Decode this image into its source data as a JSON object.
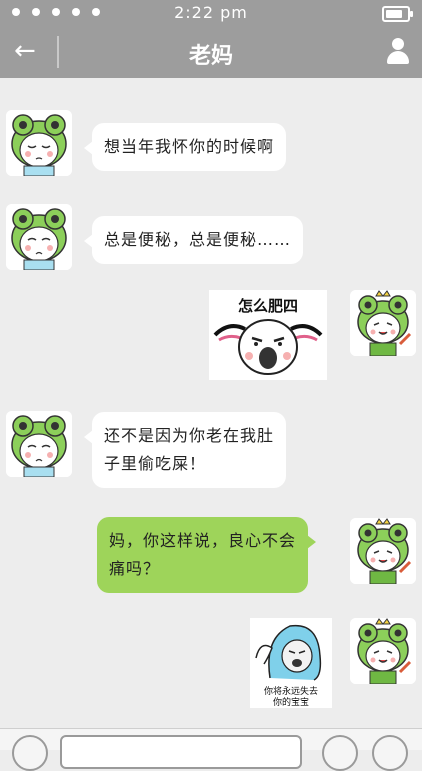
{
  "status": {
    "time": "2:22 pm"
  },
  "header": {
    "title": "老妈"
  },
  "messages": {
    "m1": "想当年我怀你的时候啊",
    "m2": "总是便秘，总是便秘……",
    "m3_sticker": "怎么肥四",
    "m4_line1": "还不是因为你老在我肚",
    "m4_line2": "子里偷吃屎！",
    "m5_line1": "妈，你这样说，良心不会",
    "m5_line2": "痛吗？",
    "m6_sticker_line1": "你将永远失去",
    "m6_sticker_line2": "你的宝宝"
  },
  "colors": {
    "bar": "#9d9d9d",
    "chat_bg": "#ededed",
    "right_bubble": "#9ed45a",
    "left_bubble": "#ffffff"
  }
}
